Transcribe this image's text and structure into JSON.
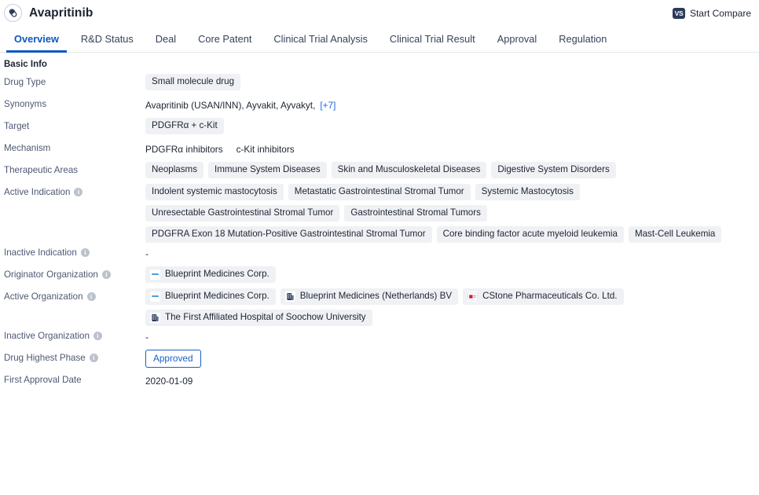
{
  "header": {
    "drug_name": "Avapritinib",
    "pill_icon": "pill-icon",
    "compare_label": "Start Compare",
    "compare_icon_text": "VS"
  },
  "tabs": [
    {
      "label": "Overview",
      "active": true
    },
    {
      "label": "R&D Status",
      "active": false
    },
    {
      "label": "Deal",
      "active": false
    },
    {
      "label": "Core Patent",
      "active": false
    },
    {
      "label": "Clinical Trial Analysis",
      "active": false
    },
    {
      "label": "Clinical Trial Result",
      "active": false
    },
    {
      "label": "Approval",
      "active": false
    },
    {
      "label": "Regulation",
      "active": false
    }
  ],
  "section": {
    "title": "Basic Info"
  },
  "rows": {
    "drug_type": {
      "label": "Drug Type",
      "chips": [
        "Small molecule drug"
      ]
    },
    "synonyms": {
      "label": "Synonyms",
      "text": "Avapritinib (USAN/INN),  Ayvakit,  Ayvakyt,",
      "more_link": "[+7]"
    },
    "target": {
      "label": "Target",
      "chips": [
        "PDGFRα + c-Kit"
      ]
    },
    "mechanism": {
      "label": "Mechanism",
      "items": [
        "PDGFRα inhibitors",
        "c-Kit inhibitors"
      ]
    },
    "therapeutic_areas": {
      "label": "Therapeutic Areas",
      "chips": [
        "Neoplasms",
        "Immune System Diseases",
        "Skin and Musculoskeletal Diseases",
        "Digestive System Disorders"
      ]
    },
    "active_indication": {
      "label": "Active Indication",
      "has_info": true,
      "chips": [
        "Indolent systemic mastocytosis",
        "Metastatic Gastrointestinal Stromal Tumor",
        "Systemic Mastocytosis",
        "Unresectable Gastrointestinal Stromal Tumor",
        "Gastrointestinal Stromal Tumors",
        "PDGFRA Exon 18 Mutation-Positive Gastrointestinal Stromal Tumor",
        "Core binding factor acute myeloid leukemia",
        "Mast-Cell Leukemia"
      ]
    },
    "inactive_indication": {
      "label": "Inactive Indication",
      "has_info": true,
      "value": "-"
    },
    "originator_organization": {
      "label": "Originator Organization",
      "has_info": true,
      "orgs": [
        {
          "name": "Blueprint Medicines Corp.",
          "logo": "blueprint-dash-logo"
        }
      ]
    },
    "active_organization": {
      "label": "Active Organization",
      "has_info": true,
      "orgs": [
        {
          "name": "Blueprint Medicines Corp.",
          "logo": "blueprint-dash-logo"
        },
        {
          "name": "Blueprint Medicines (Netherlands) BV",
          "logo": "building-logo"
        },
        {
          "name": "CStone Pharmaceuticals Co. Ltd.",
          "logo": "cstone-red-logo"
        },
        {
          "name": "The First Affiliated Hospital of Soochow University",
          "logo": "building-logo"
        }
      ]
    },
    "inactive_organization": {
      "label": "Inactive Organization",
      "has_info": true,
      "value": "-"
    },
    "drug_highest_phase": {
      "label": "Drug Highest Phase",
      "has_info": true,
      "badge": "Approved"
    },
    "first_approval_date": {
      "label": "First Approval Date",
      "value": "2020-01-09"
    }
  },
  "colors": {
    "accent_blue": "#0a58c2",
    "link_blue": "#1a6ae0",
    "badge_blue": "#1a5fc8",
    "chip_bg": "#f0f1f4",
    "label_gray": "#4d5871",
    "text_dark": "#1c2431"
  }
}
